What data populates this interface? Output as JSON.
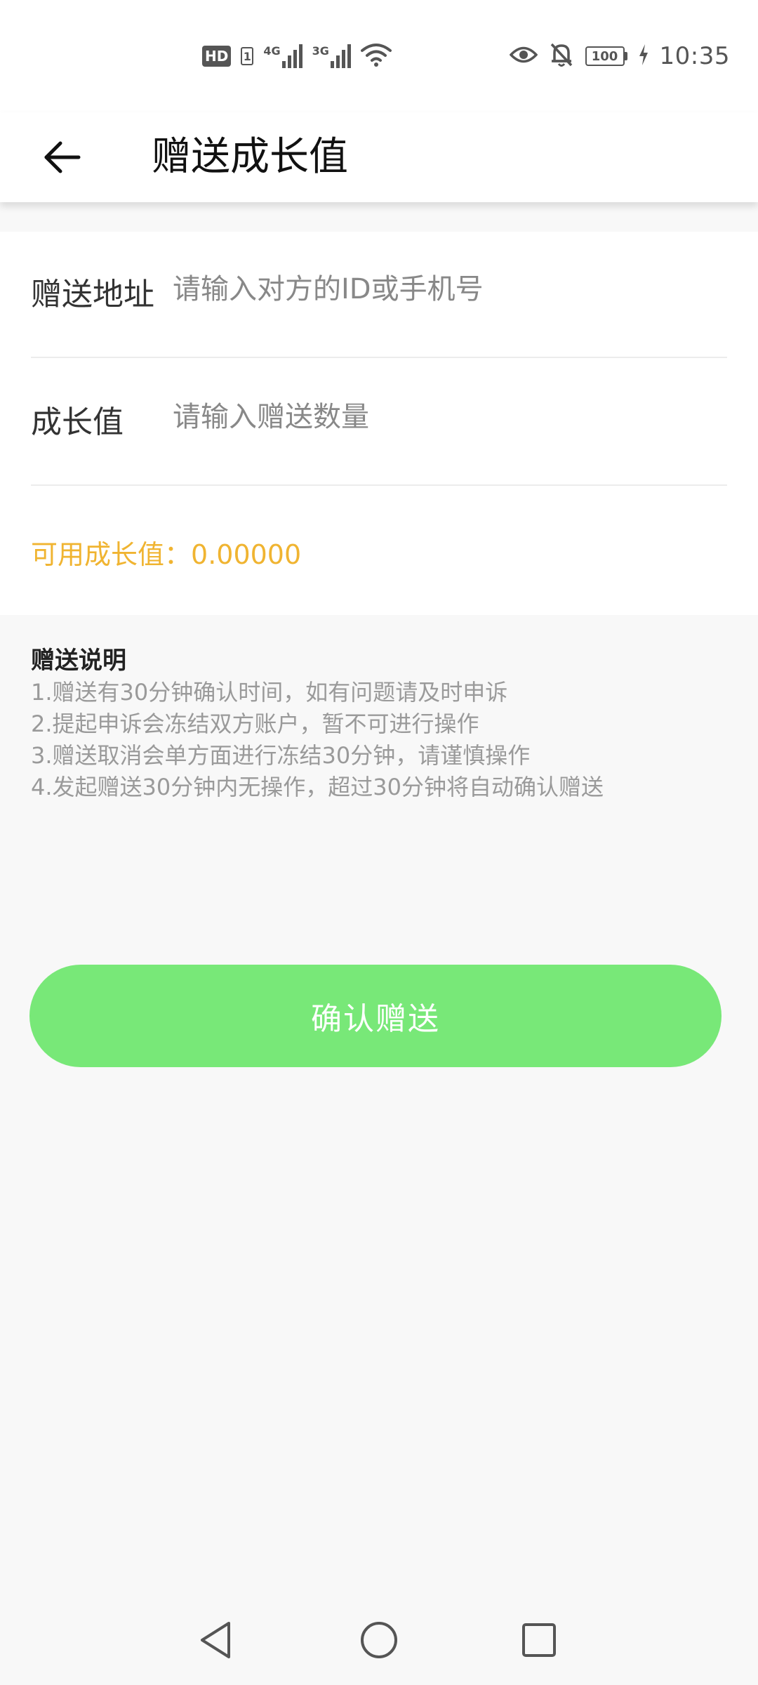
{
  "status_bar": {
    "hd_label": "HD",
    "sim_number": "1",
    "network_1": "4G",
    "network_2": "3G",
    "battery_level": "100",
    "time": "10:35"
  },
  "header": {
    "title": "赠送成长值"
  },
  "form": {
    "address": {
      "label": "赠送地址",
      "placeholder": "请输入对方的ID或手机号",
      "value": ""
    },
    "amount": {
      "label": "成长值",
      "placeholder": "请输入赠送数量",
      "value": ""
    },
    "available_label": "可用成长值：",
    "available_value": "0.00000"
  },
  "notes": {
    "title": "赠送说明",
    "items": [
      "1.赠送有30分钟确认时间，如有问题请及时申诉",
      "2.提起申诉会冻结双方账户，暂不可进行操作",
      "3.赠送取消会单方面进行冻结30分钟，请谨慎操作",
      "4.发起赠送30分钟内无操作，超过30分钟将自动确认赠送"
    ]
  },
  "confirm_button": {
    "label": "确认赠送"
  },
  "colors": {
    "accent_green": "#78e878",
    "available_orange": "#f0b431",
    "note_gray": "#9a9a9a"
  },
  "icons": {
    "back": "arrow-left-icon",
    "eye": "eye-icon",
    "bell": "bell-off-icon",
    "wifi": "wifi-icon",
    "nav_back": "triangle-back-icon",
    "nav_home": "circle-home-icon",
    "nav_recent": "square-recent-icon"
  }
}
